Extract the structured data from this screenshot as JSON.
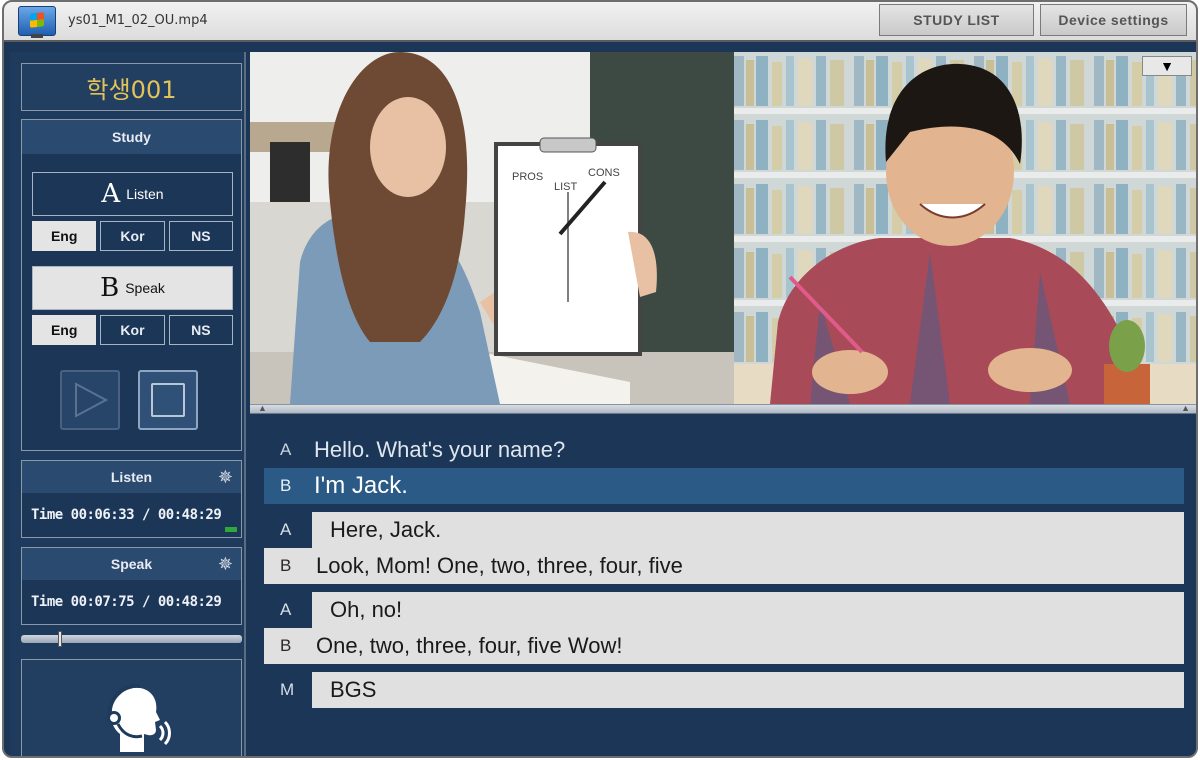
{
  "window": {
    "title": "ys01_M1_02_OU.mp4",
    "study_list_label": "STUDY LIST",
    "device_settings_label": "Device settings"
  },
  "sidebar": {
    "student_name": "학생001",
    "study_header": "Study",
    "listen_button": {
      "letter": "A",
      "label": "Listen"
    },
    "speak_button": {
      "letter": "B",
      "label": "Speak"
    },
    "listen_langs": [
      {
        "label": "Eng",
        "active": true
      },
      {
        "label": "Kor",
        "active": false
      },
      {
        "label": "NS",
        "active": false
      }
    ],
    "speak_langs": [
      {
        "label": "Eng",
        "active": true
      },
      {
        "label": "Kor",
        "active": false
      },
      {
        "label": "NS",
        "active": false
      }
    ],
    "listen_panel": {
      "title": "Listen",
      "time": "Time 00:06:33 / 00:48:29"
    },
    "speak_panel": {
      "title": "Speak",
      "time": "Time 00:07:75 / 00:48:29"
    },
    "volume_level": 0.17
  },
  "video": {
    "dropdown_symbol": "▼",
    "clipboard_words": [
      "PROS",
      "LIST",
      "CONS"
    ]
  },
  "script": {
    "lines": [
      {
        "speaker": "A",
        "text": "Hello. What's your name?"
      },
      {
        "speaker": "B",
        "text": "I'm Jack."
      },
      {
        "speaker": "A",
        "text": "Here, Jack."
      },
      {
        "speaker": "B",
        "text": "Look, Mom! One, two, three, four, five"
      },
      {
        "speaker": "A",
        "text": "Oh, no!"
      },
      {
        "speaker": "B",
        "text": "One, two, three, four, five Wow!"
      },
      {
        "speaker": "M",
        "text": "BGS"
      }
    ]
  },
  "colors": {
    "panel_bg": "#1b3656",
    "highlight": "#2a5a85",
    "student_name": "#e3c25a",
    "level_indicator": "#2fa83a"
  }
}
